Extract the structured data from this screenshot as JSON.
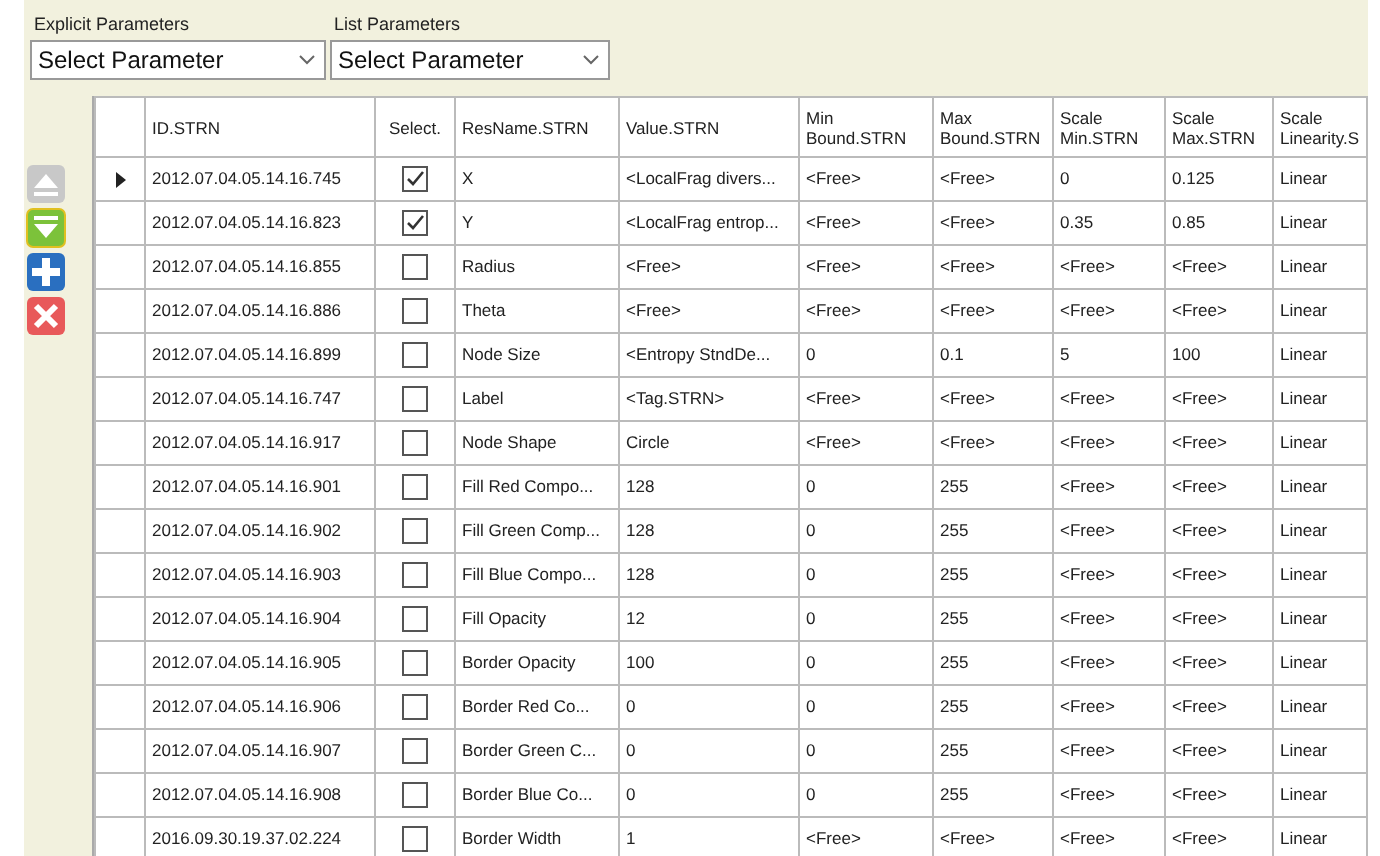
{
  "dropdowns": [
    {
      "label": "Explicit Parameters",
      "value": "Select Parameter"
    },
    {
      "label": "List Parameters",
      "value": "Select Parameter"
    }
  ],
  "toolbar": [
    {
      "kind": "up",
      "disabled": true
    },
    {
      "kind": "down",
      "disabled": false
    },
    {
      "kind": "add",
      "disabled": false
    },
    {
      "kind": "delete",
      "disabled": false
    }
  ],
  "table": {
    "columns": [
      "ID.STRN",
      "Select.",
      "ResName.STRN",
      "Value.STRN",
      "Min Bound.STRN",
      "Max Bound.STRN",
      "Scale Min.STRN",
      "Scale Max.STRN",
      "Scale Linearity.S"
    ],
    "rows": [
      {
        "current": true,
        "checked": true,
        "cells": [
          "2012.07.04.05.14.16.745",
          "",
          "X",
          "<LocalFrag divers...",
          "<Free>",
          "<Free>",
          "0",
          "0.125",
          "Linear"
        ]
      },
      {
        "current": false,
        "checked": true,
        "cells": [
          "2012.07.04.05.14.16.823",
          "",
          "Y",
          "<LocalFrag entrop...",
          "<Free>",
          "<Free>",
          "0.35",
          "0.85",
          "Linear"
        ]
      },
      {
        "current": false,
        "checked": false,
        "cells": [
          "2012.07.04.05.14.16.855",
          "",
          "Radius",
          "<Free>",
          "<Free>",
          "<Free>",
          "<Free>",
          "<Free>",
          "Linear"
        ]
      },
      {
        "current": false,
        "checked": false,
        "cells": [
          "2012.07.04.05.14.16.886",
          "",
          "Theta",
          "<Free>",
          "<Free>",
          "<Free>",
          "<Free>",
          "<Free>",
          "Linear"
        ]
      },
      {
        "current": false,
        "checked": false,
        "cells": [
          "2012.07.04.05.14.16.899",
          "",
          "Node Size",
          "<Entropy StndDe...",
          "0",
          "0.1",
          "5",
          "100",
          "Linear"
        ]
      },
      {
        "current": false,
        "checked": false,
        "cells": [
          "2012.07.04.05.14.16.747",
          "",
          "Label",
          "<Tag.STRN>",
          "<Free>",
          "<Free>",
          "<Free>",
          "<Free>",
          "Linear"
        ]
      },
      {
        "current": false,
        "checked": false,
        "cells": [
          "2012.07.04.05.14.16.917",
          "",
          "Node Shape",
          "Circle",
          "<Free>",
          "<Free>",
          "<Free>",
          "<Free>",
          "Linear"
        ]
      },
      {
        "current": false,
        "checked": false,
        "cells": [
          "2012.07.04.05.14.16.901",
          "",
          "Fill Red Compo...",
          "128",
          "0",
          "255",
          "<Free>",
          "<Free>",
          "Linear"
        ]
      },
      {
        "current": false,
        "checked": false,
        "cells": [
          "2012.07.04.05.14.16.902",
          "",
          "Fill Green Comp...",
          "128",
          "0",
          "255",
          "<Free>",
          "<Free>",
          "Linear"
        ]
      },
      {
        "current": false,
        "checked": false,
        "cells": [
          "2012.07.04.05.14.16.903",
          "",
          "Fill Blue Compo...",
          "128",
          "0",
          "255",
          "<Free>",
          "<Free>",
          "Linear"
        ]
      },
      {
        "current": false,
        "checked": false,
        "cells": [
          "2012.07.04.05.14.16.904",
          "",
          "Fill Opacity",
          "12",
          "0",
          "255",
          "<Free>",
          "<Free>",
          "Linear"
        ]
      },
      {
        "current": false,
        "checked": false,
        "cells": [
          "2012.07.04.05.14.16.905",
          "",
          "Border Opacity",
          "100",
          "0",
          "255",
          "<Free>",
          "<Free>",
          "Linear"
        ]
      },
      {
        "current": false,
        "checked": false,
        "cells": [
          "2012.07.04.05.14.16.906",
          "",
          "Border Red Co...",
          "0",
          "0",
          "255",
          "<Free>",
          "<Free>",
          "Linear"
        ]
      },
      {
        "current": false,
        "checked": false,
        "cells": [
          "2012.07.04.05.14.16.907",
          "",
          "Border Green C...",
          "0",
          "0",
          "255",
          "<Free>",
          "<Free>",
          "Linear"
        ]
      },
      {
        "current": false,
        "checked": false,
        "cells": [
          "2012.07.04.05.14.16.908",
          "",
          "Border Blue Co...",
          "0",
          "0",
          "255",
          "<Free>",
          "<Free>",
          "Linear"
        ]
      },
      {
        "current": false,
        "checked": false,
        "cells": [
          "2016.09.30.19.37.02.224",
          "",
          "Border Width",
          "1",
          "<Free>",
          "<Free>",
          "<Free>",
          "<Free>",
          "Linear"
        ]
      }
    ]
  }
}
